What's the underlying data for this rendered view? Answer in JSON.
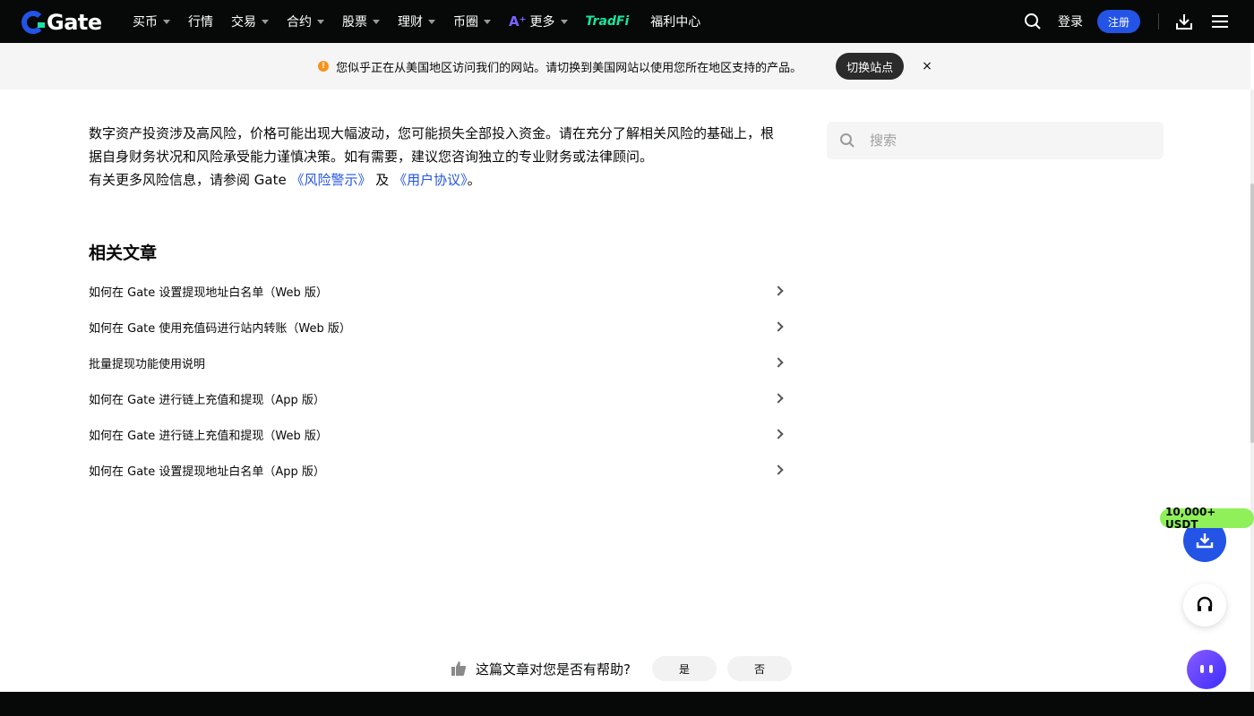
{
  "nav": {
    "logo": "Gate",
    "items": [
      {
        "label": "买币",
        "caret": true
      },
      {
        "label": "行情",
        "caret": false
      },
      {
        "label": "交易",
        "caret": true
      },
      {
        "label": "合约",
        "caret": true
      },
      {
        "label": "股票",
        "caret": true
      },
      {
        "label": "理财",
        "caret": true
      },
      {
        "label": "币圈",
        "caret": true
      },
      {
        "label": "更多",
        "caret": true
      }
    ],
    "tradfi": "TradFi",
    "welfare": "福利中心",
    "login": "登录",
    "signup": "注册"
  },
  "banner": {
    "text": "您似乎正在从美国地区访问我们的网站。请切换到美国网站以使用您所在地区支持的产品。",
    "switch_label": "切换站点",
    "close": "×"
  },
  "disclaimer": {
    "line1": "数字资产投资涉及高风险，价格可能出现大幅波动，您可能损失全部投入资金。请在充分了解相关风险的基础上，根据自身财务状况和风险承受能力谨慎决策。如有需要，建议您咨询独立的专业财务或法律顾问。",
    "line2_prefix": "有关更多风险信息，请参阅 Gate ",
    "risk_link": "《风险警示》",
    "and": "及",
    "agreement_link": "《用户协议》",
    "period": "。"
  },
  "search": {
    "placeholder": "搜索"
  },
  "related": {
    "title": "相关文章",
    "items": [
      "如何在 Gate 设置提现地址白名单（Web 版）",
      "如何在 Gate 使用充值码进行站内转账（Web 版）",
      "批量提现功能使用说明",
      "如何在 Gate 进行链上充值和提现（App 版）",
      "如何在 Gate 进行链上充值和提现（Web 版）",
      "如何在 Gate 设置提现地址白名单（App 版）"
    ]
  },
  "feedback": {
    "question": "这篇文章对您是否有帮助?",
    "yes": "是",
    "no": "否"
  },
  "promo": {
    "badge": "10,000+ USDT"
  },
  "colors": {
    "brand": "#2354e6",
    "dark": "#070808",
    "promo": "#8ff05a"
  }
}
